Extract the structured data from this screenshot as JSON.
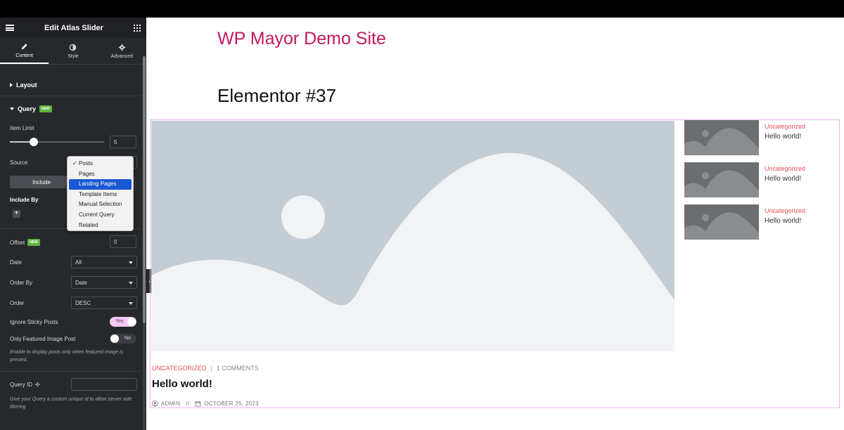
{
  "panel": {
    "title": "Edit Atlas Slider",
    "tabs": [
      {
        "label": "Content",
        "icon": "pencil-icon"
      },
      {
        "label": "Style",
        "icon": "half-circle-icon"
      },
      {
        "label": "Advanced",
        "icon": "gear-icon"
      }
    ],
    "layout_section": "Layout",
    "query_section": "Query",
    "new_badge": "NEW",
    "item_limit_label": "Item Limit",
    "item_limit_value": "5",
    "item_limit_fraction": 0.25,
    "source_label": "Source",
    "source_options": [
      "Posts",
      "Pages",
      "Landing Pages",
      "Template Items",
      "Manual Selection",
      "Current Query",
      "Related"
    ],
    "source_checked": "Posts",
    "source_highlighted": "Landing Pages",
    "include_label": "Include",
    "include_by_label": "Include By",
    "include_add": "+",
    "offset_label": "Offset",
    "offset_value": "0",
    "date_label": "Date",
    "date_value": "All",
    "order_by_label": "Order By",
    "order_by_value": "Date",
    "order_label": "Order",
    "order_value": "DESC",
    "ignore_sticky_label": "Ignore Sticky Posts",
    "ignore_sticky_value": "Yes",
    "featured_only_label": "Only Featured Image Post",
    "featured_only_value": "No",
    "featured_help": "Enable to display posts only when featured image is present.",
    "query_id_label": "Query ID",
    "query_id_help": "Give your Query a custom unique id to allow server side filtering"
  },
  "preview": {
    "site_title": "WP Mayor Demo Site",
    "page_title": "Elementor #37",
    "main_post": {
      "category": "UNCATEGORIZED",
      "separator": "|",
      "comments": "1 COMMENTS",
      "title": "Hello world!",
      "author": "ADMIN",
      "byline_sep": "//",
      "date": "OCTOBER 25, 2023"
    },
    "side_posts": [
      {
        "category": "Uncategorized",
        "title": "Hello world!"
      },
      {
        "category": "Uncategorized",
        "title": "Hello world!"
      },
      {
        "category": "Uncategorized",
        "title": "Hello world!"
      }
    ]
  },
  "colors": {
    "site_title": "#c3185f",
    "category": "#e34e5b",
    "panel_bg": "#26292c",
    "frame_outline": "#f0b2ef",
    "placeholder_bg": "#c5cdd4"
  }
}
